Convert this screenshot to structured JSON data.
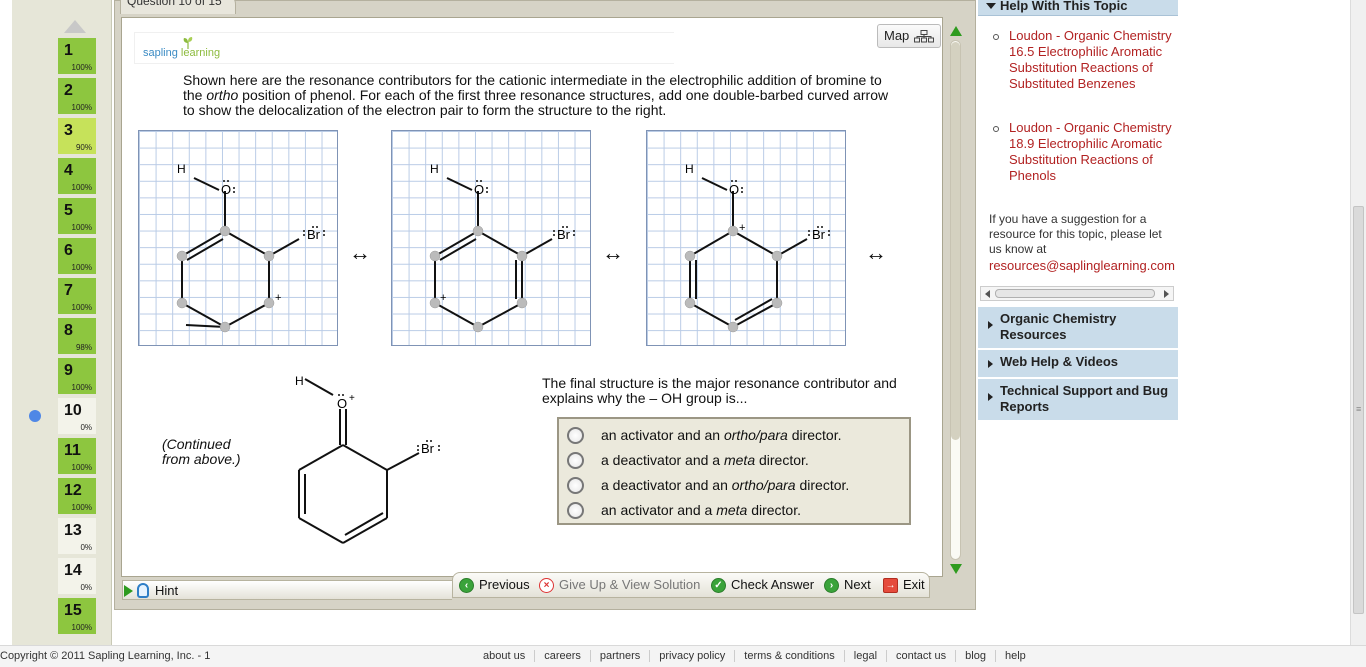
{
  "question_tab": "Question 10 of 15",
  "nav_items": [
    {
      "num": "1",
      "pct": "100%",
      "state": "g100"
    },
    {
      "num": "2",
      "pct": "100%",
      "state": "g100"
    },
    {
      "num": "3",
      "pct": "90%",
      "state": "g90"
    },
    {
      "num": "4",
      "pct": "100%",
      "state": "g100"
    },
    {
      "num": "5",
      "pct": "100%",
      "state": "g100"
    },
    {
      "num": "6",
      "pct": "100%",
      "state": "g100"
    },
    {
      "num": "7",
      "pct": "100%",
      "state": "g100"
    },
    {
      "num": "8",
      "pct": "98%",
      "state": "g100"
    },
    {
      "num": "9",
      "pct": "100%",
      "state": "g100"
    },
    {
      "num": "10",
      "pct": "0%",
      "state": "g0"
    },
    {
      "num": "11",
      "pct": "100%",
      "state": "g100"
    },
    {
      "num": "12",
      "pct": "100%",
      "state": "g100"
    },
    {
      "num": "13",
      "pct": "0%",
      "state": "g0"
    },
    {
      "num": "14",
      "pct": "0%",
      "state": "g0"
    },
    {
      "num": "15",
      "pct": "100%",
      "state": "g100"
    }
  ],
  "logo": {
    "part1": "sapling",
    "part2": "learning"
  },
  "map_label": "Map",
  "prompt": {
    "before": "Shown here are the resonance contributors for the cationic intermediate in the electrophilic addition of bromine to the ",
    "italic": "ortho",
    "after": " position of phenol. For each of the first three resonance structures, add one double-barbed curved arrow to show the delocalization of the electron pair to form the structure to the right."
  },
  "structure_labels": {
    "h": "H",
    "o": "O",
    "br": "Br",
    "plus": "+",
    "arrow": "↔"
  },
  "continued_label": {
    "line1": "(Continued",
    "line2": "from above.)"
  },
  "question_text": "The final structure is the major resonance contributor and explains why the – OH group is...",
  "choices": [
    {
      "pre": "an activator and an ",
      "em": "ortho/para",
      "post": " director."
    },
    {
      "pre": "a deactivator and a ",
      "em": "meta",
      "post": " director."
    },
    {
      "pre": "a deactivator and an ",
      "em": "ortho/para",
      "post": " director."
    },
    {
      "pre": "an activator and a ",
      "em": "meta",
      "post": " director."
    }
  ],
  "toolbar": {
    "hint": "Hint",
    "previous": "Previous",
    "give_up": "Give Up & View Solution",
    "check": "Check Answer",
    "next": "Next",
    "exit": "Exit"
  },
  "help": {
    "header": "Help With This Topic",
    "links": [
      "Loudon - Organic Chemistry 16.5 Electrophilic Aromatic Substitution Reactions of Substituted Benzenes",
      "Loudon - Organic Chemistry 18.9 Electrophilic Aromatic Substitution Reactions of Phenols"
    ],
    "suggest": "If you have a suggestion for a resource for this topic, please let us know at",
    "email": "resources@saplinglearning.com",
    "sections": [
      "Organic Chemistry Resources",
      "Web Help & Videos",
      "Technical Support and Bug Reports"
    ]
  },
  "footer": {
    "copyright": "Copyright © 2011 Sapling Learning, Inc. - 1",
    "links": [
      "about us",
      "careers",
      "partners",
      "privacy policy",
      "terms & conditions",
      "legal",
      "contact us",
      "blog",
      "help"
    ]
  }
}
